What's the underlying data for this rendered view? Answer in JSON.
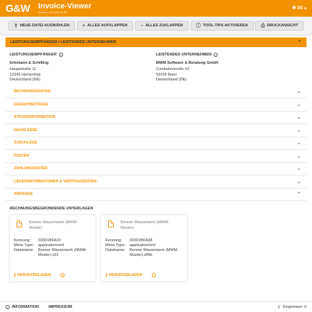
{
  "header": {
    "logo": "G&W",
    "title": "Invoice-Viewer",
    "version": "Version: 24.1031.11.38",
    "language": "DE",
    "globe_icon": "globe-icon",
    "caret_icon": "caret-down-icon"
  },
  "toolbar": {
    "buttons": [
      {
        "label": "NEUE DATEI AUSWÄHLEN",
        "icon": "upload-icon",
        "glyph": "⇪"
      },
      {
        "label": "ALLES AUFKLAPPEN",
        "icon": "plus-icon",
        "glyph": "+"
      },
      {
        "label": "ALLES ZUKLAPPEN",
        "icon": "minus-icon",
        "glyph": "−"
      },
      {
        "label": "TOOL-TIPS AKTIVIEREN",
        "icon": "info-icon",
        "glyph": "ⓘ"
      },
      {
        "label": "DRUCKANSICHT",
        "icon": "print-icon",
        "glyph": "⎙"
      }
    ]
  },
  "main_section": {
    "title": "LEISTUNGSEMPFÄNGER / LEISTENDES UNTERNEHMEN",
    "recipient": {
      "heading": "LEISTUNGSEMPFÄNGER",
      "name": "Erlemann & Schilling",
      "street": "Hauptstraße 11",
      "city": "12345 Hementhal",
      "country": "Deutschland (DE)"
    },
    "supplier": {
      "heading": "LEISTENDES UNTERNEHMEN",
      "name": "MWM Software & Beratung GmbH",
      "street": "Combahnstraße 43",
      "city": "53225 Bonn",
      "country": "Deutschland (DE)"
    }
  },
  "sections": [
    {
      "label": "RECHNUNGSDATEN",
      "chevron": "⌄"
    },
    {
      "label": "GESAMTBETRÄGE",
      "chevron": "⌄"
    },
    {
      "label": "STEUERINFORMATION",
      "chevron": "⌄"
    },
    {
      "label": "NACHLÄSSE",
      "chevron": "⌄"
    },
    {
      "label": "ZUSCHLÄGE",
      "chevron": "⌄"
    },
    {
      "label": "POSTEN",
      "chevron": "⌄"
    },
    {
      "label": "ZAHLUNGSDATEN",
      "chevron": "⌄"
    },
    {
      "label": "LIEFERINFORMATIONEN & VERTRAGSDATEN",
      "chevron": "⌄"
    },
    {
      "label": "ANHÄNGE",
      "chevron": "⌃"
    }
  ],
  "attachments": {
    "title": "RECHNUNGSBEGRÜNDENDE UNTERLAGEN",
    "download_label": "HERUNTERLADEN",
    "labels": {
      "id": "Kennung:",
      "mime": "Mime Type:",
      "filename": "Dateiname:"
    },
    "cards": [
      {
        "name": "Bonner Wasserwerk (MWM-Muster)",
        "id": "ID0D1BFA10",
        "mime": "application/xml",
        "filename": "Bonner Wasserwerk (MWM-Muster).x31"
      },
      {
        "name": "Bonner Wasserwerk (MWM-Muster)",
        "id": "ID0D1BFA38",
        "mime": "application/xml",
        "filename": "Bonner Wasserwerk (MWM-Muster).x89b"
      }
    ]
  },
  "footer": {
    "info_label": "INFORMATION",
    "imprint_label": "IMPRESSUM",
    "read_label": "Eingelesen: 5"
  },
  "colors": {
    "accent": "#f39200"
  }
}
